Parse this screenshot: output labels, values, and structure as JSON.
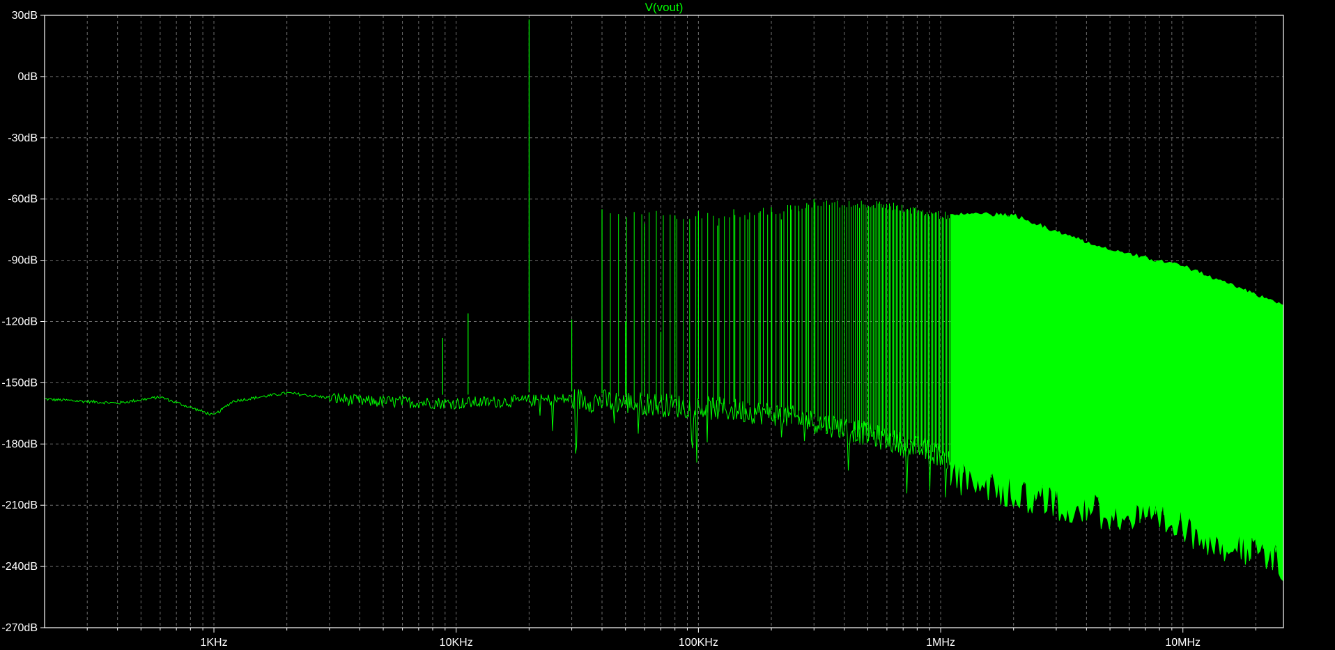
{
  "chart_data": {
    "type": "line",
    "title": "V(vout)",
    "xlabel": "",
    "ylabel": "",
    "x_scale": "log",
    "xlim_hz": [
      200,
      26000000
    ],
    "ylim_db": [
      -270,
      30
    ],
    "grid": true,
    "background_color": "#000000",
    "trace_color": "#00ff00",
    "axis_color": "#ffffff",
    "y_ticks": [
      {
        "value": 30,
        "label": "30dB"
      },
      {
        "value": 0,
        "label": "0dB"
      },
      {
        "value": -30,
        "label": "-30dB"
      },
      {
        "value": -60,
        "label": "-60dB"
      },
      {
        "value": -90,
        "label": "-90dB"
      },
      {
        "value": -120,
        "label": "-120dB"
      },
      {
        "value": -150,
        "label": "-150dB"
      },
      {
        "value": -180,
        "label": "-180dB"
      },
      {
        "value": -210,
        "label": "-210dB"
      },
      {
        "value": -240,
        "label": "-240dB"
      },
      {
        "value": -270,
        "label": "-270dB"
      }
    ],
    "x_ticks": [
      {
        "value": 1000,
        "label": "1KHz"
      },
      {
        "value": 10000,
        "label": "10KHz"
      },
      {
        "value": 100000,
        "label": "100KHz"
      },
      {
        "value": 1000000,
        "label": "1MHz"
      },
      {
        "value": 10000000,
        "label": "10MHz"
      }
    ],
    "series": [
      {
        "name": "V(vout)",
        "noise_floor": [
          {
            "x": 200,
            "y": -158
          },
          {
            "x": 400,
            "y": -160
          },
          {
            "x": 600,
            "y": -157
          },
          {
            "x": 1000,
            "y": -166
          },
          {
            "x": 1200,
            "y": -159
          },
          {
            "x": 2000,
            "y": -155
          },
          {
            "x": 4000,
            "y": -159
          },
          {
            "x": 10000,
            "y": -160
          },
          {
            "x": 30000,
            "y": -158
          },
          {
            "x": 100000,
            "y": -162
          },
          {
            "x": 200000,
            "y": -165
          },
          {
            "x": 400000,
            "y": -172
          },
          {
            "x": 800000,
            "y": -182
          },
          {
            "x": 2000000,
            "y": -195
          },
          {
            "x": 5000000,
            "y": -205
          },
          {
            "x": 10000000,
            "y": -212
          },
          {
            "x": 20000000,
            "y": -225
          },
          {
            "x": 26000000,
            "y": -230
          }
        ],
        "harmonic_envelope": [
          {
            "x": 40000,
            "y": -65
          },
          {
            "x": 100000,
            "y": -66
          },
          {
            "x": 200000,
            "y": -64
          },
          {
            "x": 300000,
            "y": -60
          },
          {
            "x": 600000,
            "y": -61
          },
          {
            "x": 1000000,
            "y": -66
          },
          {
            "x": 2000000,
            "y": -67
          },
          {
            "x": 3000000,
            "y": -75
          },
          {
            "x": 5000000,
            "y": -84
          },
          {
            "x": 10000000,
            "y": -92
          },
          {
            "x": 26000000,
            "y": -111
          }
        ],
        "fill_start_hz": 1100000,
        "spikes": [
          {
            "x": 8800,
            "y": -128
          },
          {
            "x": 11200,
            "y": -116
          },
          {
            "x": 20000,
            "y": 28
          },
          {
            "x": 30000,
            "y": -119
          },
          {
            "x": 40000,
            "y": -65
          },
          {
            "x": 50000,
            "y": -120
          },
          {
            "x": 60000,
            "y": -72
          },
          {
            "x": 70000,
            "y": -125
          },
          {
            "x": 80000,
            "y": -68
          },
          {
            "x": 100000,
            "y": -66
          },
          {
            "x": 120000,
            "y": -73
          },
          {
            "x": 140000,
            "y": -65
          },
          {
            "x": 160000,
            "y": -70
          },
          {
            "x": 180000,
            "y": -66
          },
          {
            "x": 200000,
            "y": -64
          },
          {
            "x": 220000,
            "y": -70
          },
          {
            "x": 240000,
            "y": -63
          },
          {
            "x": 260000,
            "y": -66
          },
          {
            "x": 280000,
            "y": -62
          },
          {
            "x": 300000,
            "y": -60
          },
          {
            "x": 1900000,
            "y": -68
          }
        ]
      }
    ]
  }
}
